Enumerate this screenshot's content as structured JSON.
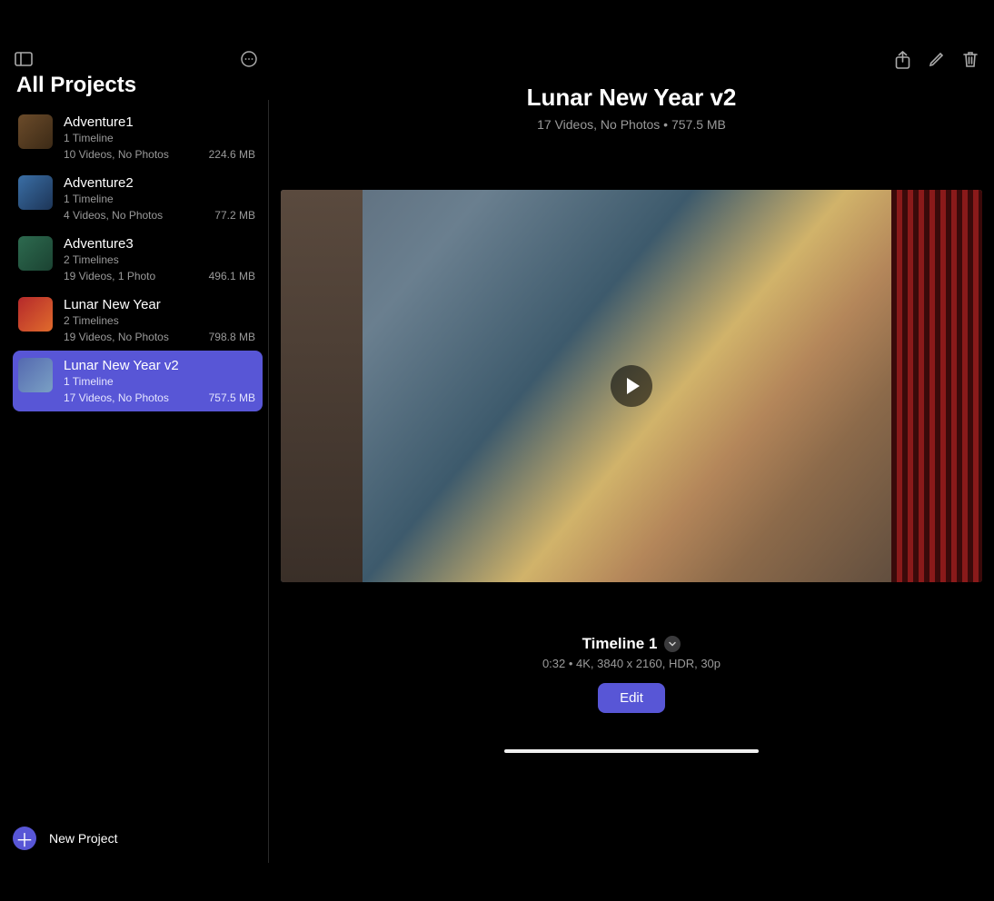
{
  "sidebar": {
    "title": "All Projects",
    "projects": [
      {
        "name": "Adventure1",
        "timelines": "1 Timeline",
        "media": "10 Videos, No Photos",
        "size": "224.6 MB"
      },
      {
        "name": "Adventure2",
        "timelines": "1 Timeline",
        "media": "4 Videos, No Photos",
        "size": "77.2 MB"
      },
      {
        "name": "Adventure3",
        "timelines": "2 Timelines",
        "media": "19 Videos, 1 Photo",
        "size": "496.1 MB"
      },
      {
        "name": "Lunar New Year",
        "timelines": "2 Timelines",
        "media": "19 Videos, No Photos",
        "size": "798.8 MB"
      },
      {
        "name": "Lunar New Year v2",
        "timelines": "1 Timeline",
        "media": "17 Videos, No Photos",
        "size": "757.5 MB"
      }
    ],
    "new_project_label": "New Project"
  },
  "main": {
    "title": "Lunar New Year v2",
    "subtitle": "17 Videos, No Photos • 757.5 MB",
    "timeline": {
      "name": "Timeline 1",
      "meta": "0:32 • 4K, 3840 x 2160, HDR, 30p",
      "edit_label": "Edit"
    }
  },
  "icons": {
    "sidebar_toggle": "sidebar-toggle-icon",
    "more": "ellipsis-circle-icon",
    "share": "share-icon",
    "edit_pencil": "pencil-icon",
    "trash": "trash-icon",
    "play": "play-icon",
    "chevron_down": "chevron-down-icon",
    "plus": "plus-icon"
  }
}
